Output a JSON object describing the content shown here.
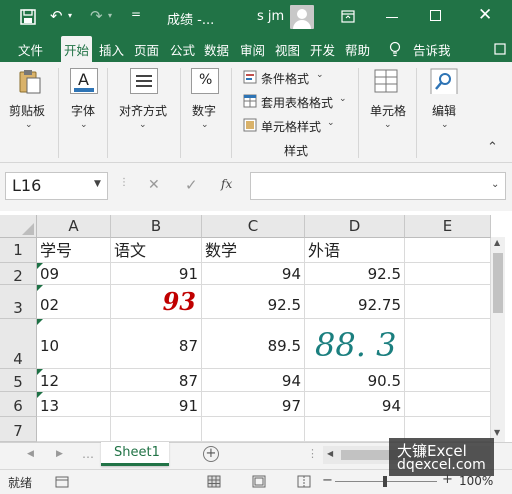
{
  "titlebar": {
    "file_title": "成绩  -...",
    "user": "s jm",
    "quick_access_more": "="
  },
  "tabs": [
    "文件",
    "开始",
    "插入",
    "页面",
    "公式",
    "数据",
    "审阅",
    "视图",
    "开发",
    "帮助",
    "告诉我"
  ],
  "ribbon": {
    "clipboard_label": "剪贴板",
    "font_label": "字体",
    "font_glyph": "A",
    "align_label": "对齐方式",
    "number_label": "数字",
    "number_glyph": "%",
    "cond_format": "条件格式",
    "table_format": "套用表格格式",
    "cell_style": "单元格样式",
    "styles_group": "样式",
    "cells_label": "单元格",
    "edit_label": "编辑"
  },
  "formula_bar": {
    "name_box": "L16",
    "fx": "fx",
    "formula": ""
  },
  "columns": [
    "A",
    "B",
    "C",
    "D",
    "E"
  ],
  "rows": [
    {
      "num": "1",
      "cells": [
        "学号",
        "语文",
        "数学",
        "外语",
        ""
      ]
    },
    {
      "num": "2",
      "cells": [
        "09",
        "91",
        "94",
        "92.5",
        ""
      ]
    },
    {
      "num": "3",
      "cells": [
        "02",
        "93",
        "92.5",
        "92.75",
        ""
      ]
    },
    {
      "num": "4",
      "cells": [
        "10",
        "87",
        "89.5",
        "88. 3",
        ""
      ]
    },
    {
      "num": "5",
      "cells": [
        "12",
        "87",
        "94",
        "90.5",
        ""
      ]
    },
    {
      "num": "6",
      "cells": [
        "13",
        "91",
        "97",
        "94",
        ""
      ]
    },
    {
      "num": "7",
      "cells": [
        "",
        "",
        "",
        "",
        ""
      ]
    }
  ],
  "sheet_tab": "Sheet1",
  "add_sheet": "+",
  "status": {
    "ready": "就绪",
    "zoom": "100%"
  },
  "watermark": {
    "line1": "大镰Excel",
    "line2": "dqexcel.com"
  },
  "colors": {
    "excel_green": "#217346",
    "red_value": "#c00000",
    "teal_value": "#1b7f7f"
  }
}
